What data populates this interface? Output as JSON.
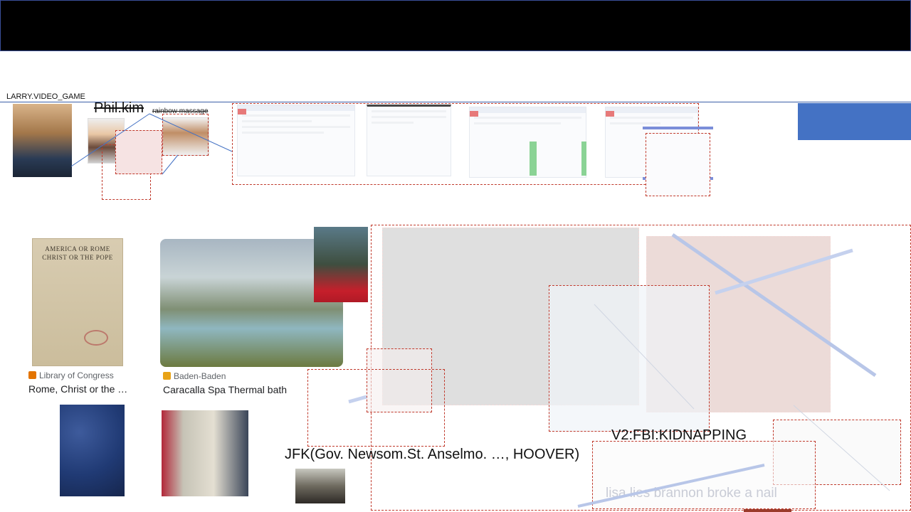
{
  "header": {
    "label": "LARRY.VIDEO_GAME"
  },
  "annotations": {
    "phil": "Phil.kim",
    "rainbow": "rainbow massage",
    "jfk": "JFK(Gov. Newsom.St. Anselmo. …, HOOVER)",
    "v2": "V2:FBI:KIDNAPPING",
    "faded_text": "lisa lies brannon broke a nail"
  },
  "results": [
    {
      "source": "Library of Congress",
      "caption": "Rome, Christ or the …",
      "icon_color": "#e37400"
    },
    {
      "source": "Baden-Baden",
      "caption": "Caracalla Spa Thermal bath",
      "icon_color": "#e8a317"
    }
  ],
  "book": {
    "lines": [
      "AMERICA OR ROME",
      "CHRIST OR THE POPE"
    ]
  },
  "colors": {
    "accent_blue": "#4472c4",
    "dash_red": "#c0392b",
    "topbar": "#000000"
  }
}
